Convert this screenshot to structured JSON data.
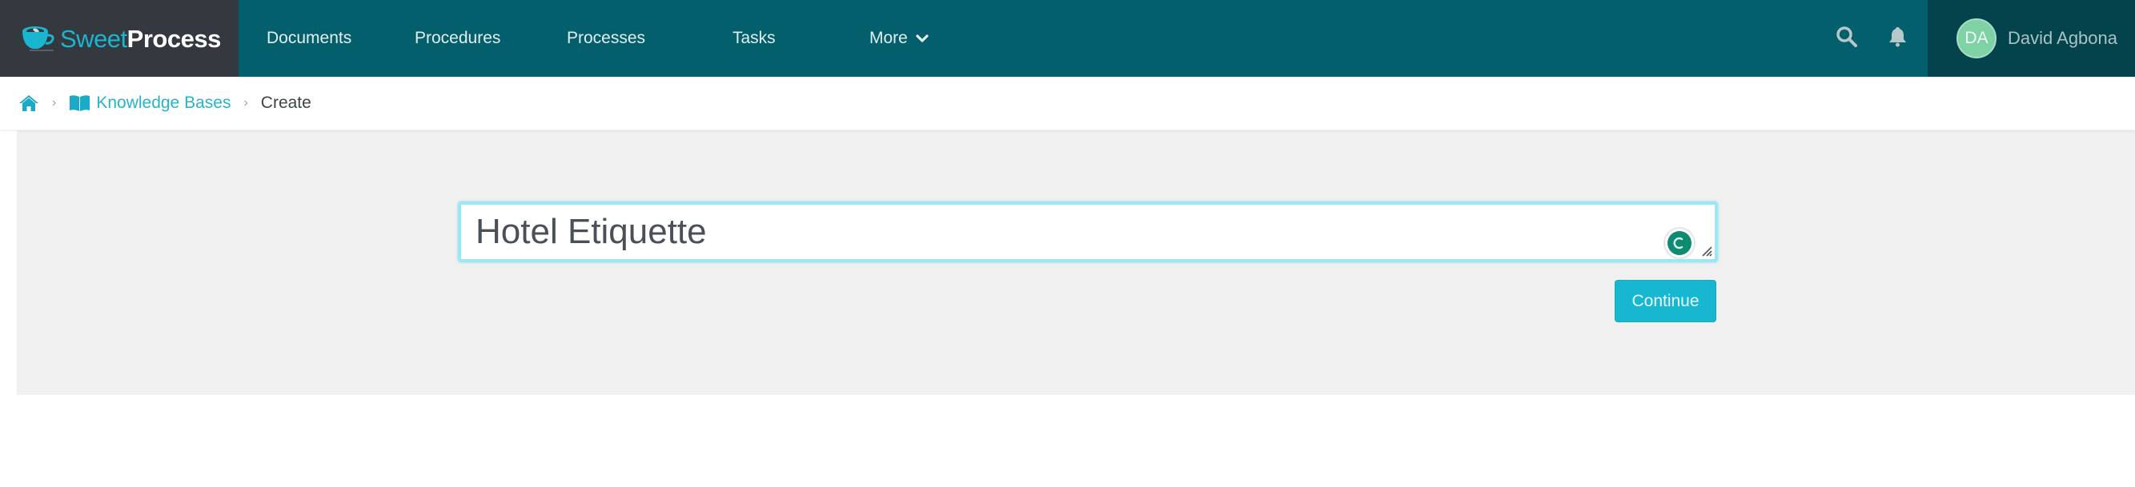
{
  "brand": {
    "name_part1": "Sweet",
    "name_part2": "Process",
    "icon": "coffee-cup-logo-icon"
  },
  "nav": {
    "items": [
      {
        "label": "Documents"
      },
      {
        "label": "Procedures"
      },
      {
        "label": "Processes"
      },
      {
        "label": "Tasks"
      },
      {
        "label": "More",
        "icon": "chevron-down-icon"
      }
    ],
    "search_icon": "search-icon",
    "notifications_icon": "bell-icon",
    "user": {
      "initials": "DA",
      "name": "David Agbona"
    }
  },
  "breadcrumb": {
    "home_icon": "home-icon",
    "items": [
      {
        "label": "Knowledge Bases",
        "icon": "book-icon"
      },
      {
        "label": "Create"
      }
    ],
    "separator": "›"
  },
  "form": {
    "title_value": "Hotel Etiquette",
    "grammar_badge_icon": "grammarly-icon",
    "continue_label": "Continue"
  },
  "colors": {
    "navbar": "#035f6b",
    "brand_bg": "#34383f",
    "user_area": "#03434c",
    "accent": "#17b6d1",
    "link": "#28b3cc",
    "avatar": "#7fd1a6"
  }
}
